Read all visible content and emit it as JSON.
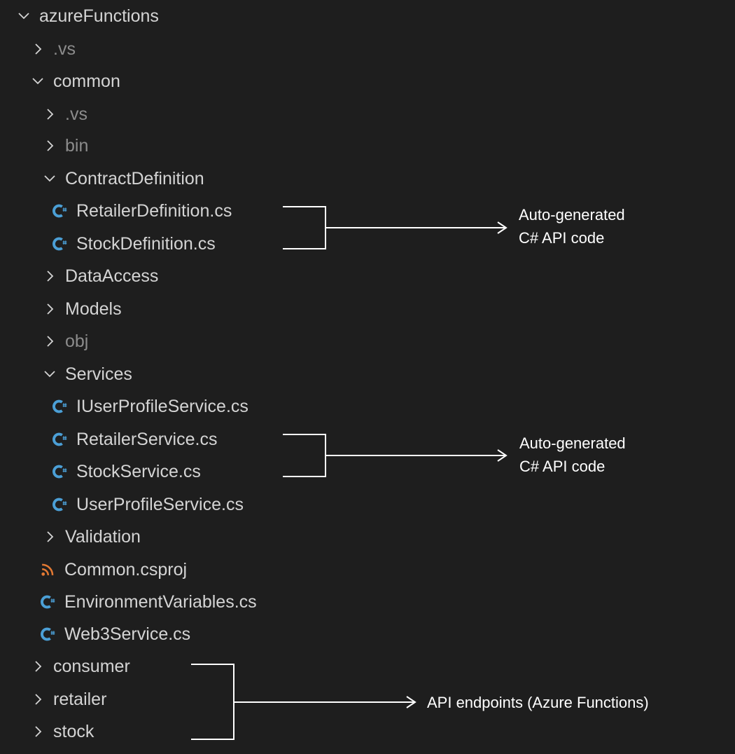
{
  "tree": {
    "root": {
      "label": "azureFunctions",
      "expanded": true
    },
    "items": [
      {
        "label": ".vs",
        "type": "folder",
        "expanded": false,
        "dim": true
      },
      {
        "label": "common",
        "type": "folder",
        "expanded": true,
        "dim": false
      },
      {
        "label": ".vs",
        "type": "folder",
        "expanded": false,
        "dim": true
      },
      {
        "label": "bin",
        "type": "folder",
        "expanded": false,
        "dim": true
      },
      {
        "label": "ContractDefinition",
        "type": "folder",
        "expanded": true,
        "dim": false
      },
      {
        "label": "RetailerDefinition.cs",
        "type": "cs-file"
      },
      {
        "label": "StockDefinition.cs",
        "type": "cs-file"
      },
      {
        "label": "DataAccess",
        "type": "folder",
        "expanded": false,
        "dim": false
      },
      {
        "label": "Models",
        "type": "folder",
        "expanded": false,
        "dim": false
      },
      {
        "label": "obj",
        "type": "folder",
        "expanded": false,
        "dim": true
      },
      {
        "label": "Services",
        "type": "folder",
        "expanded": true,
        "dim": false
      },
      {
        "label": "IUserProfileService.cs",
        "type": "cs-file"
      },
      {
        "label": "RetailerService.cs",
        "type": "cs-file"
      },
      {
        "label": "StockService.cs",
        "type": "cs-file"
      },
      {
        "label": "UserProfileService.cs",
        "type": "cs-file"
      },
      {
        "label": "Validation",
        "type": "folder",
        "expanded": false,
        "dim": false
      },
      {
        "label": "Common.csproj",
        "type": "rss-file"
      },
      {
        "label": "EnvironmentVariables.cs",
        "type": "cs-file"
      },
      {
        "label": "Web3Service.cs",
        "type": "cs-file"
      },
      {
        "label": "consumer",
        "type": "folder",
        "expanded": false,
        "dim": false
      },
      {
        "label": "retailer",
        "type": "folder",
        "expanded": false,
        "dim": false
      },
      {
        "label": "stock",
        "type": "folder",
        "expanded": false,
        "dim": false
      }
    ]
  },
  "annotations": [
    {
      "line1": "Auto-generated",
      "line2": "C# API code"
    },
    {
      "line1": "Auto-generated",
      "line2": "C# API code"
    },
    {
      "line1": "API endpoints (Azure Functions)",
      "line2": ""
    }
  ],
  "colors": {
    "background": "#1e1e1e",
    "text": "#d4d4d4",
    "dimText": "#8c8c8c",
    "csIcon": "#4b9fd6",
    "rssIcon": "#e37933",
    "annotation": "#ffffff"
  },
  "icons": {
    "collapsed": "chevron-right-icon",
    "expanded": "chevron-down-icon",
    "csFile": "csharp-file-icon",
    "csproj": "rss-icon"
  }
}
